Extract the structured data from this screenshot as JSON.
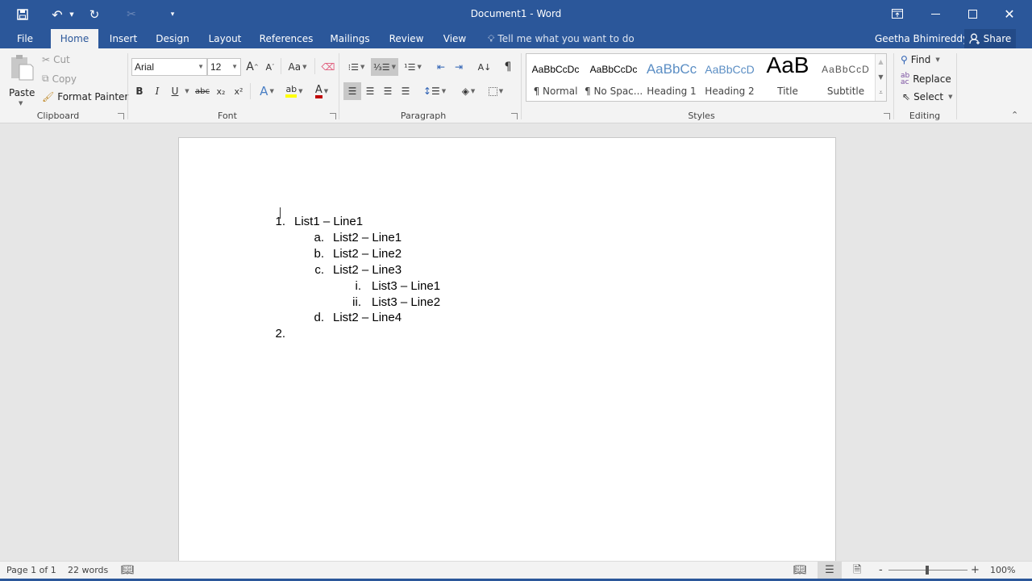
{
  "window": {
    "title": "Document1 - Word",
    "controls": {
      "ribbon_display": "ribbon-display-options",
      "minimize": "minimize",
      "maximize": "maximize",
      "close": "close"
    }
  },
  "quick_access": {
    "save": "save-icon",
    "undo": "undo-icon",
    "redo": "repeat-icon",
    "cut": "cut-icon",
    "customize": "customize-qat-icon"
  },
  "tabs": [
    {
      "label": "File"
    },
    {
      "label": "Home",
      "active": true
    },
    {
      "label": "Insert"
    },
    {
      "label": "Design"
    },
    {
      "label": "Layout"
    },
    {
      "label": "References"
    },
    {
      "label": "Mailings"
    },
    {
      "label": "Review"
    },
    {
      "label": "View"
    }
  ],
  "tell_me": "Tell me what you want to do",
  "user": "Geetha Bhimireddy",
  "share_label": "Share",
  "ribbon": {
    "clipboard": {
      "label": "Clipboard",
      "paste": "Paste",
      "cut": "Cut",
      "copy": "Copy",
      "format_painter": "Format Painter"
    },
    "font": {
      "label": "Font",
      "font_name": "Arial",
      "font_size": "12",
      "grow": "A",
      "shrink": "A",
      "change_case": "Aa",
      "bold": "B",
      "italic": "I",
      "underline": "U",
      "strike": "abc",
      "subscript": "x₂",
      "superscript": "x²",
      "text_effects": "A",
      "highlight": "ab",
      "font_color": "A",
      "highlight_color": "#ffff00",
      "font_color_value": "#c00000"
    },
    "paragraph": {
      "label": "Paragraph",
      "pilcrow": "¶"
    },
    "styles": {
      "label": "Styles",
      "items": [
        {
          "preview": "AaBbCcDc",
          "name": "¶ Normal"
        },
        {
          "preview": "AaBbCcDc",
          "name": "¶ No Spac..."
        },
        {
          "preview": "AaBbCc",
          "name": "Heading 1"
        },
        {
          "preview": "AaBbCcD",
          "name": "Heading 2"
        },
        {
          "preview": "AaB",
          "name": "Title"
        },
        {
          "preview": "AaBbCcD",
          "name": "Subtitle"
        }
      ]
    },
    "editing": {
      "label": "Editing",
      "find": "Find",
      "replace": "Replace",
      "select": "Select"
    }
  },
  "document": {
    "list": [
      {
        "marker": "1.",
        "text": "List1 – Line1",
        "level": 1
      },
      {
        "marker": "a.",
        "text": "List2 – Line1",
        "level": 2
      },
      {
        "marker": "b.",
        "text": "List2 – Line2",
        "level": 2
      },
      {
        "marker": "c.",
        "text": "List2 – Line3",
        "level": 2
      },
      {
        "marker": "i.",
        "text": "List3 – Line1",
        "level": 3
      },
      {
        "marker": "ii.",
        "text": "List3 – Line2",
        "level": 3
      },
      {
        "marker": "d.",
        "text": "List2 – Line4",
        "level": 2
      },
      {
        "marker": "2.",
        "text": "",
        "level": 1
      }
    ]
  },
  "status": {
    "page": "Page 1 of 1",
    "words": "22 words",
    "zoom": "100%",
    "zoom_minus": "-",
    "zoom_plus": "+"
  },
  "colors": {
    "brand": "#2b579a",
    "ribbon_bg": "#f3f3f3",
    "canvas_bg": "#e6e6e6"
  }
}
